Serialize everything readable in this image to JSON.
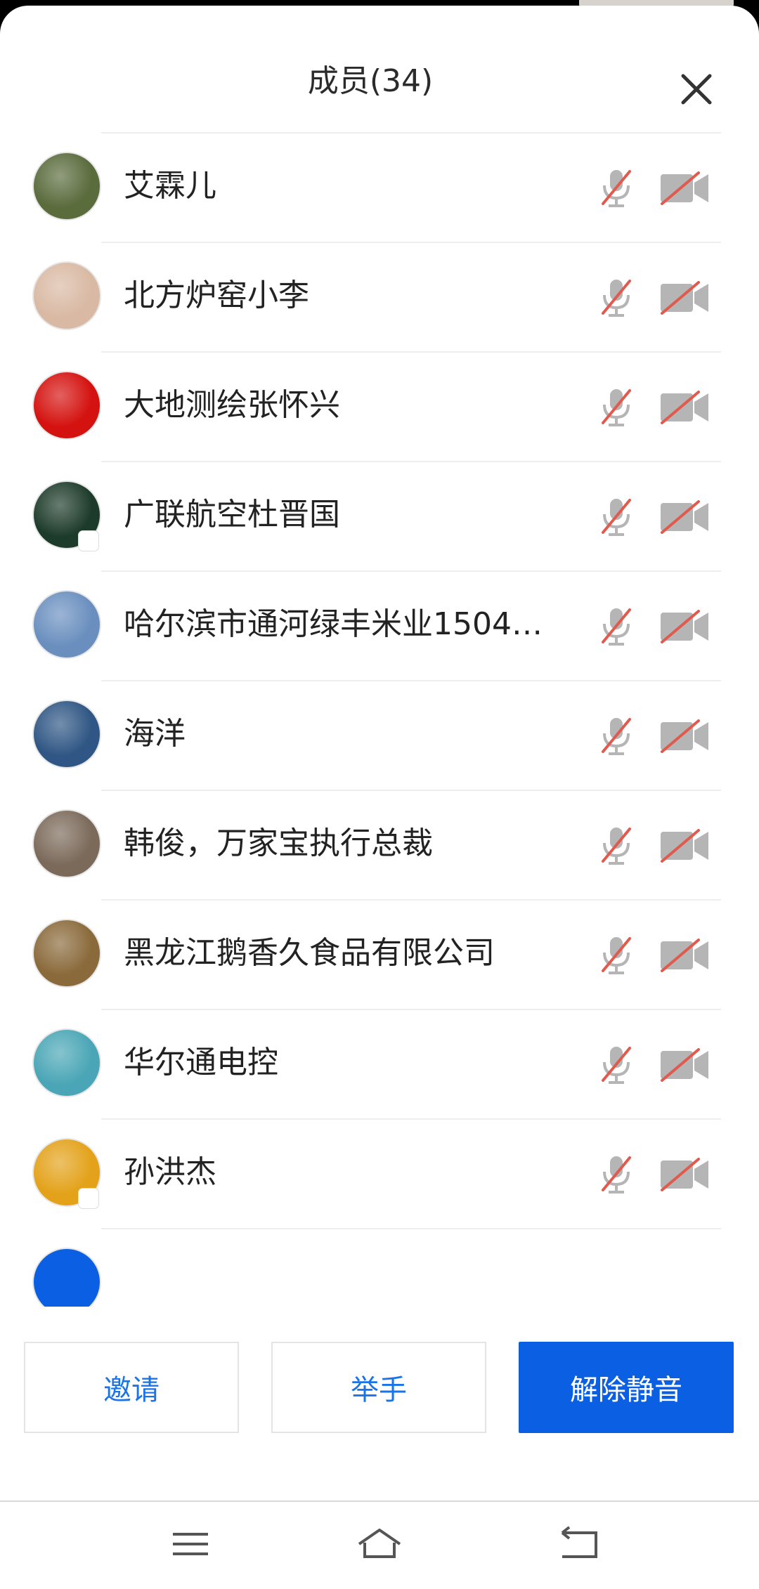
{
  "header": {
    "title": "成员(34)"
  },
  "members": [
    {
      "name": "艾霖儿",
      "avatar_color": "#5a6b3c",
      "badge": false
    },
    {
      "name": "北方炉窑小李",
      "avatar_color": "#d9b9a3",
      "badge": false
    },
    {
      "name": "大地测绘张怀兴",
      "avatar_color": "#d4120f",
      "badge": false
    },
    {
      "name": "广联航空杜晋国",
      "avatar_color": "#1d3b2a",
      "badge": true
    },
    {
      "name": "哈尔滨市通河绿丰米业1504…",
      "avatar_color": "#6a8fbf",
      "badge": false
    },
    {
      "name": "海洋",
      "avatar_color": "#2f5684",
      "badge": false
    },
    {
      "name": "韩俊，万家宝执行总裁",
      "avatar_color": "#7b6a5a",
      "badge": false
    },
    {
      "name": "黑龙江鹅香久食品有限公司",
      "avatar_color": "#8a6a3b",
      "badge": false
    },
    {
      "name": "华尔通电控",
      "avatar_color": "#4aa6b6",
      "badge": false
    },
    {
      "name": "孙洪杰",
      "avatar_color": "#e3a21a",
      "badge": true
    }
  ],
  "footer": {
    "invite_label": "邀请",
    "raise_hand_label": "举手",
    "unmute_label": "解除静音"
  },
  "colors": {
    "accent": "#0b5fe3",
    "muted_icon": "#b5b5b5",
    "muted_slash": "#e05a4e"
  }
}
